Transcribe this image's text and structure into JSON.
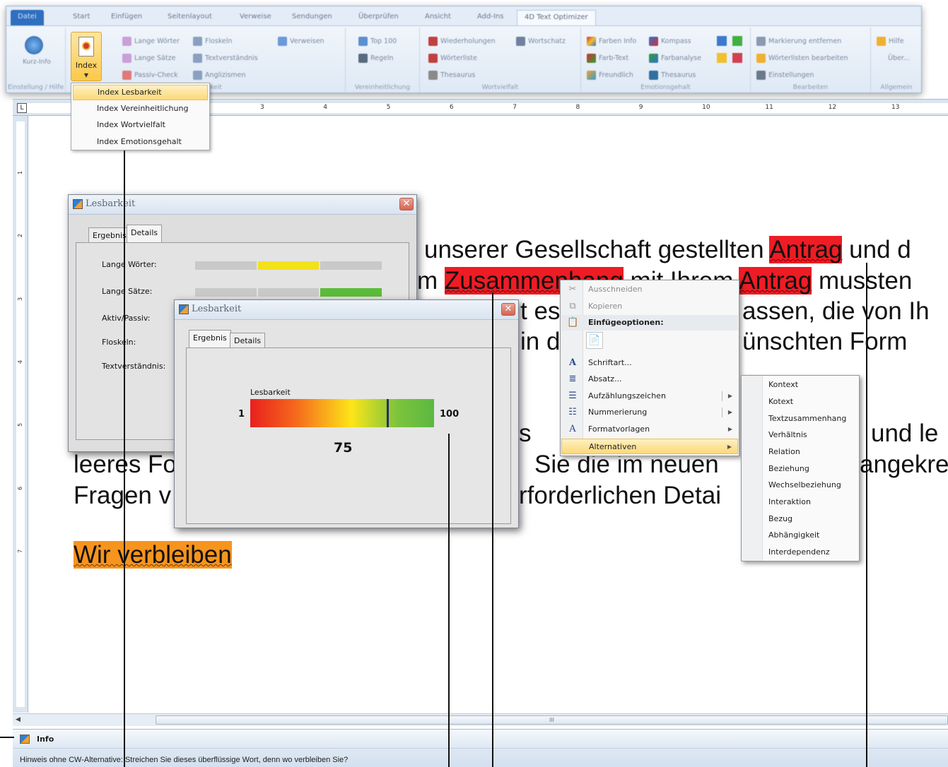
{
  "ribbon": {
    "tabs": [
      "Datei",
      "Start",
      "Einfügen",
      "Seitenlayout",
      "Verweise",
      "Sendungen",
      "Überprüfen",
      "Ansicht",
      "Add-Ins",
      "4D Text Optimizer"
    ],
    "index_button_label": "Index",
    "group_labels": [
      "Einstellung / Hilfe",
      "Lesbarkeit",
      "Vereinheitlichung",
      "Wortvielfalt",
      "Emotionsgehalt",
      "Bearbeiten",
      "Allgemein"
    ],
    "buttons": {
      "kurz_info": "Kurz-Info",
      "lange_woerter": "Lange Wörter",
      "lange_saetze": "Lange Sätze",
      "passiv_check": "Passiv-Check",
      "floskeln": "Floskeln",
      "textverstaendnis": "Textverständnis",
      "anglizismen": "Anglizismen",
      "verweise": "Verweisen",
      "top_100": "Top 100",
      "regeln": "Regeln",
      "wiederholungen": "Wiederholungen",
      "wortschatz": "Wortschatz",
      "woerterliste": "Wörterliste",
      "thesaurus": "Thesaurus",
      "farben_info": "Farben Info",
      "farb_text": "Farb-Text",
      "freundlich": "Freundlich",
      "kompass": "Kompass",
      "farbanalyse": "Farbanalyse",
      "thesaurus2": "Thesaurus",
      "markierung_entfernen": "Markierung entfernen",
      "woerterlisten_bearbeiten": "Wörterlisten bearbeiten",
      "einstellungen": "Einstellungen",
      "hilfe": "Hilfe",
      "ueber": "Über..."
    }
  },
  "index_menu": {
    "items": [
      "Index Lesbarkeit",
      "Index Vereinheitlichung",
      "Index Wortvielfalt",
      "Index Emotionsgehalt"
    ],
    "highlighted": "Index Lesbarkeit"
  },
  "ruler": {
    "corner": "L",
    "numbers": [
      "3",
      "4",
      "5",
      "6",
      "7",
      "8",
      "9",
      "10",
      "11",
      "12",
      "13"
    ],
    "v_numbers": [
      "1",
      "2",
      "3",
      "4",
      "5",
      "6",
      "7"
    ]
  },
  "document": {
    "line1": {
      "pre": "unserer Gesellschaft gestellten ",
      "hl": "Antrag",
      "post": " und d"
    },
    "line2": {
      "pre": "m ",
      "hl": "Zusammenhang",
      "mid": " mit Ihrem ",
      "hl2": "Antrag",
      "post": " mussten"
    },
    "line3a": "t es",
    "line3b": "assen, die von Ih",
    "line4a": "in d",
    "line4b": "ünschten Form",
    "line5a": "s",
    "line5b": "und le",
    "line6a": "leeres Fo",
    "line6b": "Sie die im neuen",
    "line6c": "angekre",
    "line7a": "Fragen v",
    "line7b": "rforderlichen Detai",
    "closing": "Wir verbleiben"
  },
  "dialog_details": {
    "title": "Lesbarkeit",
    "tabs": [
      "Ergebnis",
      "Details"
    ],
    "active_tab": "Details",
    "rows": [
      {
        "label": "Lange Wörter:",
        "level": 2,
        "color": "#f2e11b"
      },
      {
        "label": "Lange Sätze:",
        "level": 3,
        "color": "#5cbc3a"
      },
      {
        "label": "Aktiv/Passiv:"
      },
      {
        "label": "Floskeln:"
      },
      {
        "label": "Textverständnis:"
      }
    ]
  },
  "dialog_result": {
    "title": "Lesbarkeit",
    "tabs": [
      "Ergebnis",
      "Details"
    ],
    "active_tab": "Ergebnis",
    "gauge_label": "Lesbarkeit",
    "min": "1",
    "max": "100",
    "value": 75,
    "value_text": "75"
  },
  "context_menu": {
    "items": [
      {
        "label": "Ausschneiden",
        "icon": "scissors-icon",
        "state": "disabled"
      },
      {
        "label": "Kopieren",
        "icon": "copy-icon",
        "state": "disabled"
      },
      {
        "label": "Einfügeoptionen:",
        "icon": "paste-icon",
        "state": "header"
      },
      {
        "label": "",
        "icon": "paste-text-icon",
        "state": "paste-row"
      },
      {
        "label": "Schriftart...",
        "icon": "font-icon"
      },
      {
        "label": "Absatz...",
        "icon": "paragraph-icon"
      },
      {
        "label": "Aufzählungszeichen",
        "icon": "bullets-icon",
        "submenu": true
      },
      {
        "label": "Nummerierung",
        "icon": "numbering-icon",
        "submenu": true
      },
      {
        "label": "Formatvorlagen",
        "icon": "styles-icon",
        "submenu": true
      },
      {
        "label": "Alternativen",
        "icon": "",
        "submenu": true,
        "state": "highlighted"
      }
    ]
  },
  "submenu_alternativen": [
    "Kontext",
    "Kotext",
    "Textzusammenhang",
    "Verhältnis",
    "Relation",
    "Beziehung",
    "Wechselbeziehung",
    "Interaktion",
    "Bezug",
    "Abhängigkeit",
    "Interdependenz"
  ],
  "infobar": {
    "title": "Info",
    "message": "Hinweis ohne CW-Alternative:  Streichen Sie dieses überflüssige Wort, denn wo verbleiben Sie?"
  },
  "colors": {
    "highlight_red": "#ee1c24",
    "highlight_orange": "#f7941d",
    "menu_highlight": "#fcd979"
  }
}
